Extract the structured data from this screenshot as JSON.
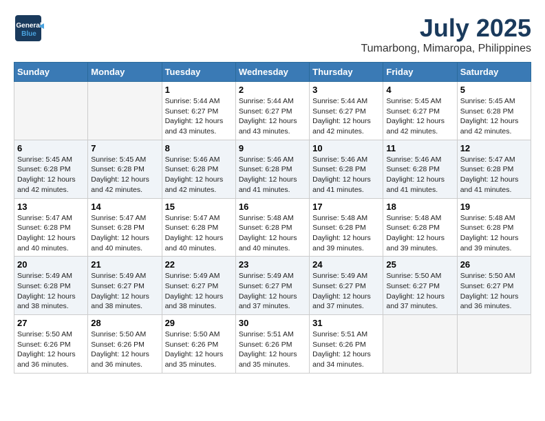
{
  "header": {
    "logo_line1": "General",
    "logo_line2": "Blue",
    "title": "July 2025",
    "subtitle": "Tumarbong, Mimaropa, Philippines"
  },
  "calendar": {
    "days_of_week": [
      "Sunday",
      "Monday",
      "Tuesday",
      "Wednesday",
      "Thursday",
      "Friday",
      "Saturday"
    ],
    "weeks": [
      [
        {
          "day": "",
          "info": ""
        },
        {
          "day": "",
          "info": ""
        },
        {
          "day": "1",
          "info": "Sunrise: 5:44 AM\nSunset: 6:27 PM\nDaylight: 12 hours\nand 43 minutes."
        },
        {
          "day": "2",
          "info": "Sunrise: 5:44 AM\nSunset: 6:27 PM\nDaylight: 12 hours\nand 43 minutes."
        },
        {
          "day": "3",
          "info": "Sunrise: 5:44 AM\nSunset: 6:27 PM\nDaylight: 12 hours\nand 42 minutes."
        },
        {
          "day": "4",
          "info": "Sunrise: 5:45 AM\nSunset: 6:27 PM\nDaylight: 12 hours\nand 42 minutes."
        },
        {
          "day": "5",
          "info": "Sunrise: 5:45 AM\nSunset: 6:28 PM\nDaylight: 12 hours\nand 42 minutes."
        }
      ],
      [
        {
          "day": "6",
          "info": "Sunrise: 5:45 AM\nSunset: 6:28 PM\nDaylight: 12 hours\nand 42 minutes."
        },
        {
          "day": "7",
          "info": "Sunrise: 5:45 AM\nSunset: 6:28 PM\nDaylight: 12 hours\nand 42 minutes."
        },
        {
          "day": "8",
          "info": "Sunrise: 5:46 AM\nSunset: 6:28 PM\nDaylight: 12 hours\nand 42 minutes."
        },
        {
          "day": "9",
          "info": "Sunrise: 5:46 AM\nSunset: 6:28 PM\nDaylight: 12 hours\nand 41 minutes."
        },
        {
          "day": "10",
          "info": "Sunrise: 5:46 AM\nSunset: 6:28 PM\nDaylight: 12 hours\nand 41 minutes."
        },
        {
          "day": "11",
          "info": "Sunrise: 5:46 AM\nSunset: 6:28 PM\nDaylight: 12 hours\nand 41 minutes."
        },
        {
          "day": "12",
          "info": "Sunrise: 5:47 AM\nSunset: 6:28 PM\nDaylight: 12 hours\nand 41 minutes."
        }
      ],
      [
        {
          "day": "13",
          "info": "Sunrise: 5:47 AM\nSunset: 6:28 PM\nDaylight: 12 hours\nand 40 minutes."
        },
        {
          "day": "14",
          "info": "Sunrise: 5:47 AM\nSunset: 6:28 PM\nDaylight: 12 hours\nand 40 minutes."
        },
        {
          "day": "15",
          "info": "Sunrise: 5:47 AM\nSunset: 6:28 PM\nDaylight: 12 hours\nand 40 minutes."
        },
        {
          "day": "16",
          "info": "Sunrise: 5:48 AM\nSunset: 6:28 PM\nDaylight: 12 hours\nand 40 minutes."
        },
        {
          "day": "17",
          "info": "Sunrise: 5:48 AM\nSunset: 6:28 PM\nDaylight: 12 hours\nand 39 minutes."
        },
        {
          "day": "18",
          "info": "Sunrise: 5:48 AM\nSunset: 6:28 PM\nDaylight: 12 hours\nand 39 minutes."
        },
        {
          "day": "19",
          "info": "Sunrise: 5:48 AM\nSunset: 6:28 PM\nDaylight: 12 hours\nand 39 minutes."
        }
      ],
      [
        {
          "day": "20",
          "info": "Sunrise: 5:49 AM\nSunset: 6:28 PM\nDaylight: 12 hours\nand 38 minutes."
        },
        {
          "day": "21",
          "info": "Sunrise: 5:49 AM\nSunset: 6:27 PM\nDaylight: 12 hours\nand 38 minutes."
        },
        {
          "day": "22",
          "info": "Sunrise: 5:49 AM\nSunset: 6:27 PM\nDaylight: 12 hours\nand 38 minutes."
        },
        {
          "day": "23",
          "info": "Sunrise: 5:49 AM\nSunset: 6:27 PM\nDaylight: 12 hours\nand 37 minutes."
        },
        {
          "day": "24",
          "info": "Sunrise: 5:49 AM\nSunset: 6:27 PM\nDaylight: 12 hours\nand 37 minutes."
        },
        {
          "day": "25",
          "info": "Sunrise: 5:50 AM\nSunset: 6:27 PM\nDaylight: 12 hours\nand 37 minutes."
        },
        {
          "day": "26",
          "info": "Sunrise: 5:50 AM\nSunset: 6:27 PM\nDaylight: 12 hours\nand 36 minutes."
        }
      ],
      [
        {
          "day": "27",
          "info": "Sunrise: 5:50 AM\nSunset: 6:26 PM\nDaylight: 12 hours\nand 36 minutes."
        },
        {
          "day": "28",
          "info": "Sunrise: 5:50 AM\nSunset: 6:26 PM\nDaylight: 12 hours\nand 36 minutes."
        },
        {
          "day": "29",
          "info": "Sunrise: 5:50 AM\nSunset: 6:26 PM\nDaylight: 12 hours\nand 35 minutes."
        },
        {
          "day": "30",
          "info": "Sunrise: 5:51 AM\nSunset: 6:26 PM\nDaylight: 12 hours\nand 35 minutes."
        },
        {
          "day": "31",
          "info": "Sunrise: 5:51 AM\nSunset: 6:26 PM\nDaylight: 12 hours\nand 34 minutes."
        },
        {
          "day": "",
          "info": ""
        },
        {
          "day": "",
          "info": ""
        }
      ]
    ]
  }
}
